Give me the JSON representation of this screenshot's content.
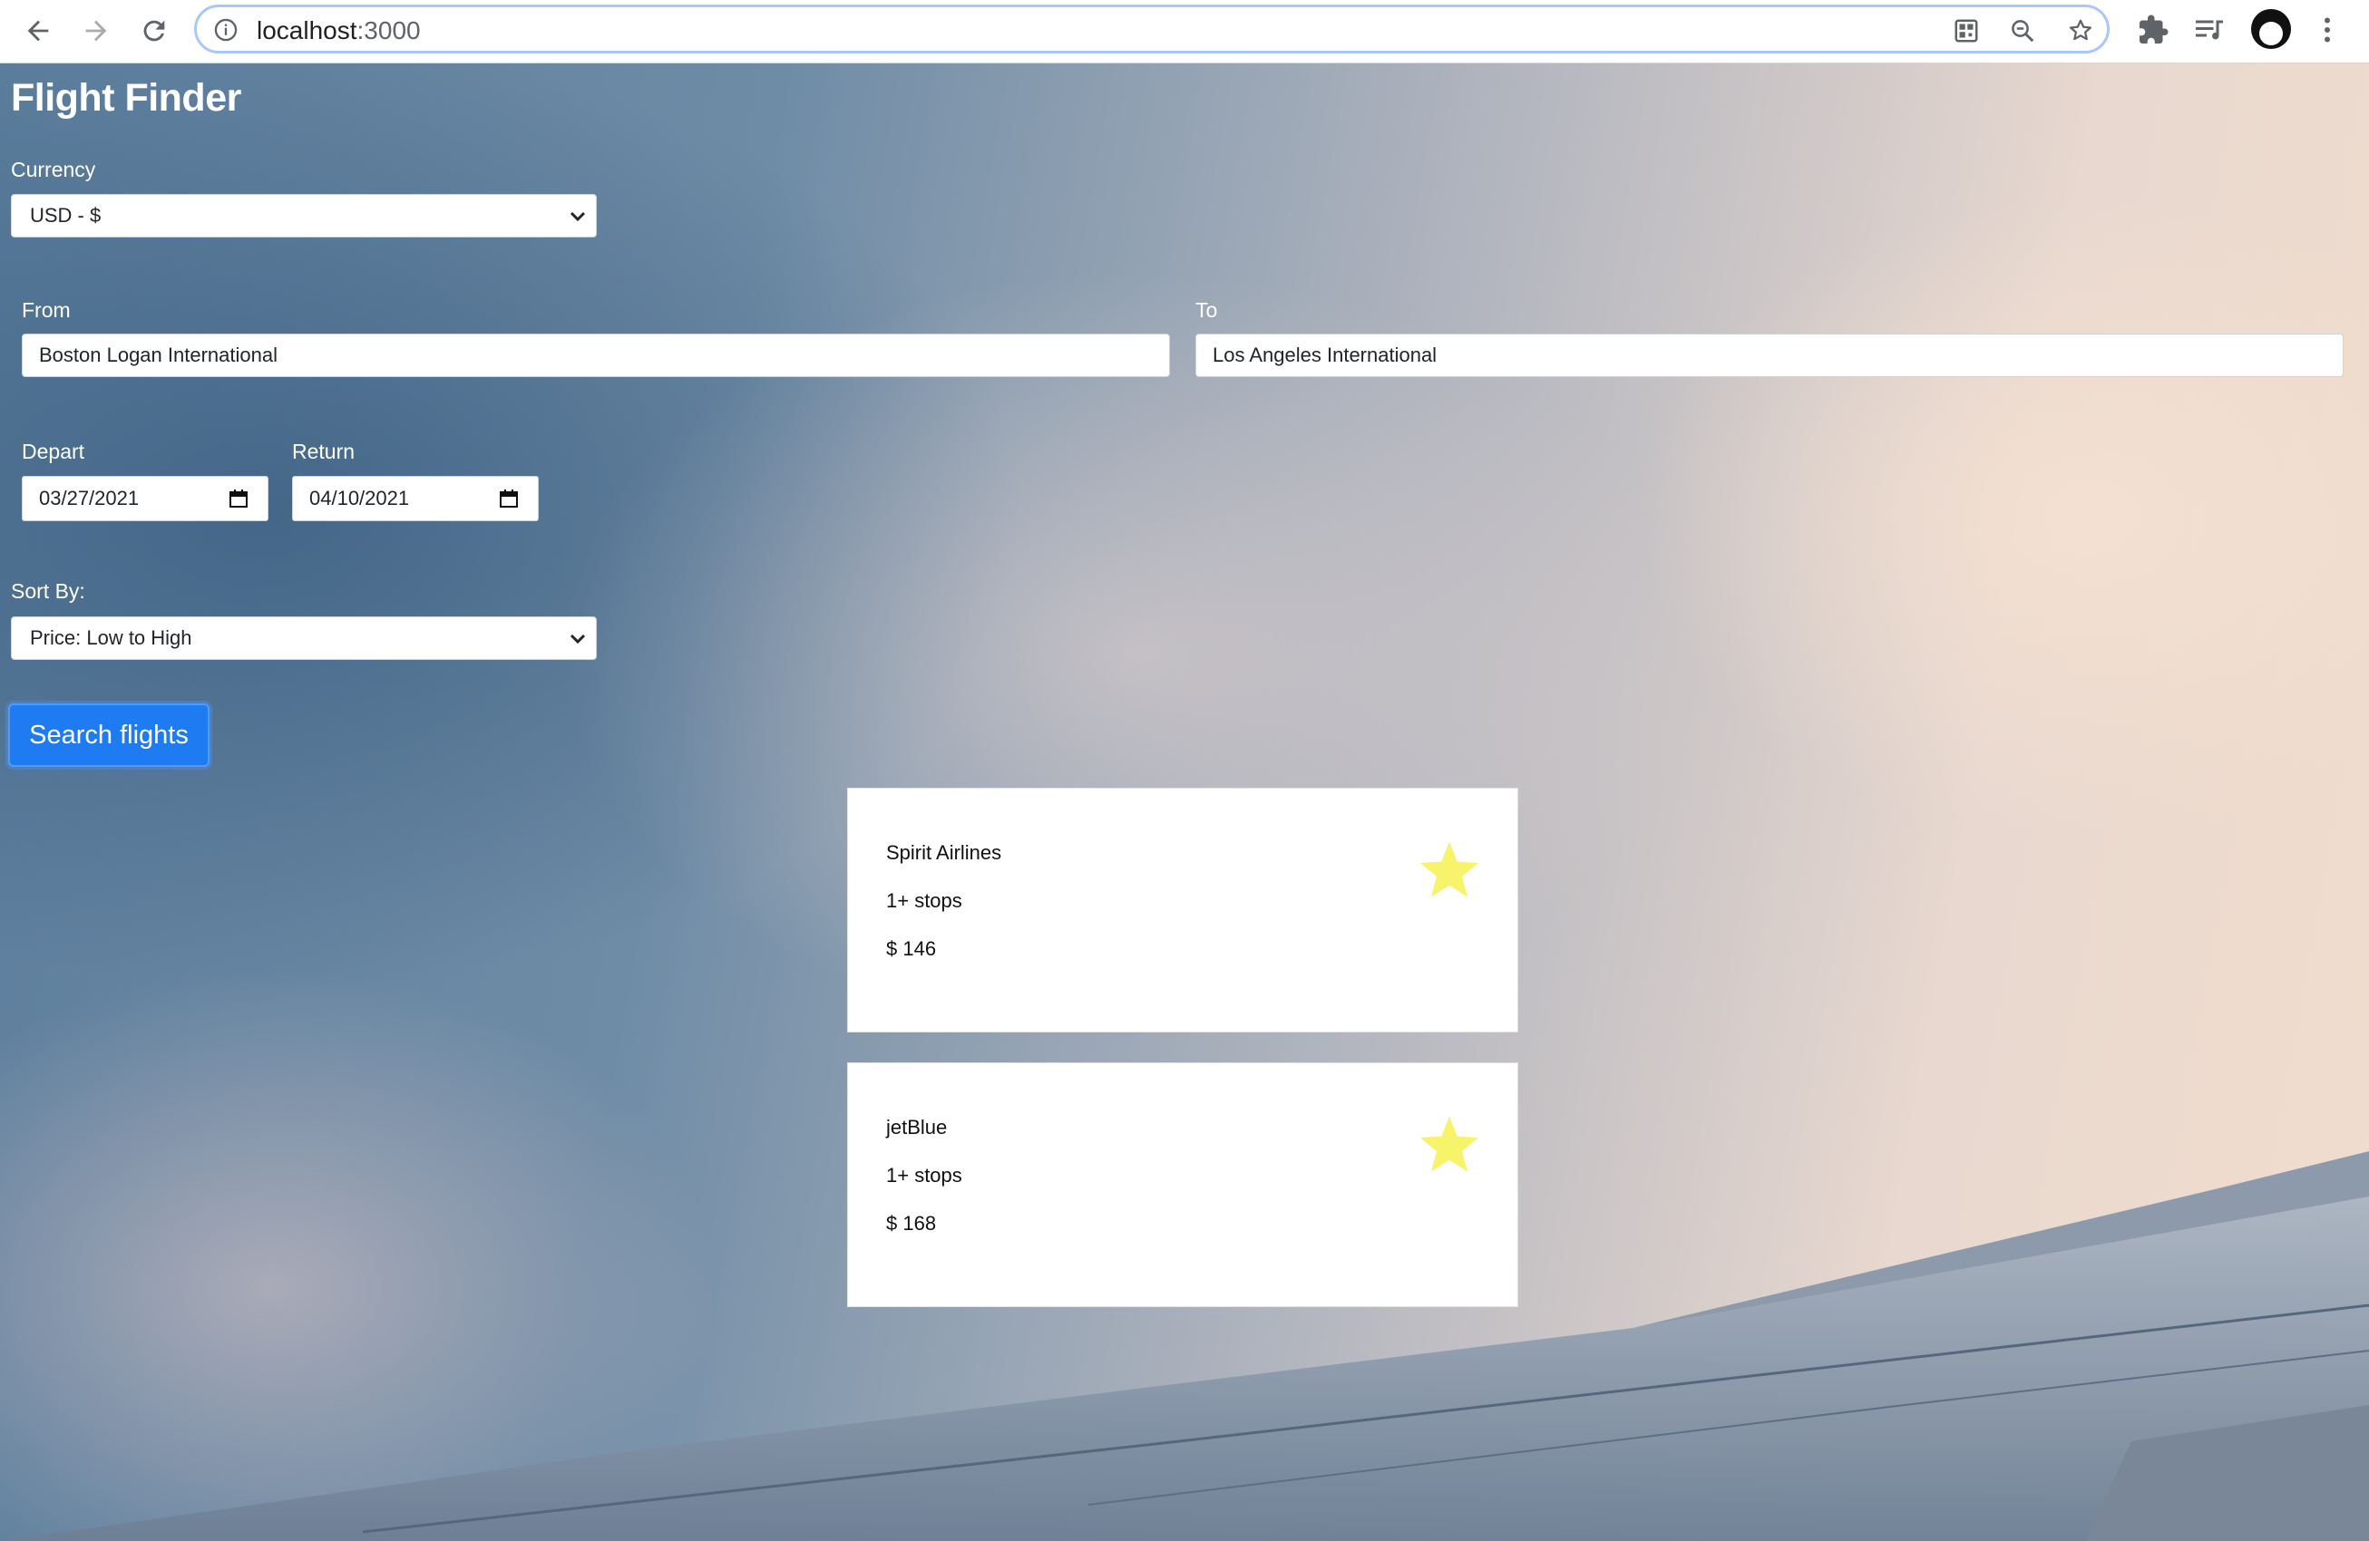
{
  "browser": {
    "url_host": "localhost",
    "url_port": ":3000"
  },
  "app": {
    "title": "Flight Finder"
  },
  "currency": {
    "label": "Currency",
    "selected": "USD - $"
  },
  "route": {
    "from_label": "From",
    "from_value": "Boston Logan International",
    "to_label": "To",
    "to_value": "Los Angeles International"
  },
  "dates": {
    "depart_label": "Depart",
    "depart_value": "03/27/2021",
    "return_label": "Return",
    "return_value": "04/10/2021"
  },
  "sort": {
    "label": "Sort By:",
    "selected": "Price: Low to High"
  },
  "search_button_label": "Search flights",
  "results": [
    {
      "airline": "Spirit Airlines",
      "stops": "1+ stops",
      "price": "$ 146",
      "favorite_icon": "star-icon"
    },
    {
      "airline": "jetBlue",
      "stops": "1+ stops",
      "price": "$ 168",
      "favorite_icon": "star-icon"
    }
  ],
  "colors": {
    "accent": "#1f7bf2",
    "star": "#f7f36a",
    "title_text": "#ffffff"
  }
}
